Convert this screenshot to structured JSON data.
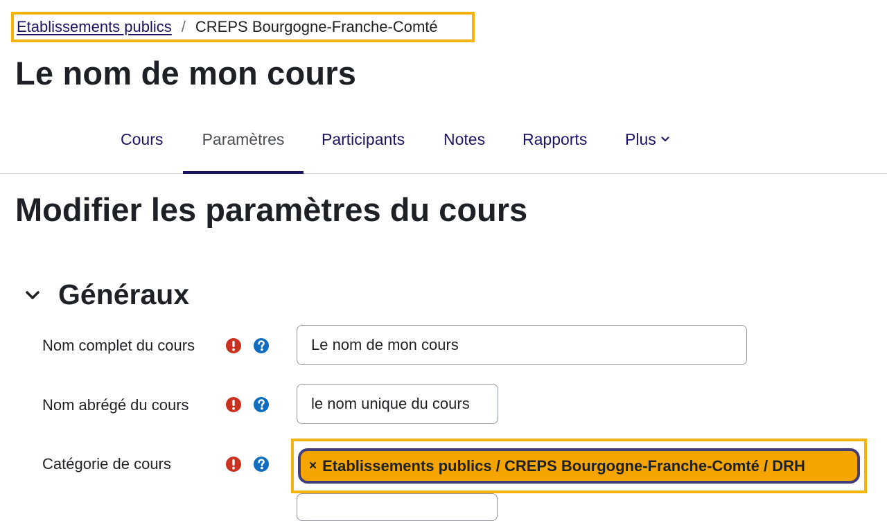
{
  "breadcrumb": {
    "items": [
      {
        "label": "Etablissements publics"
      },
      {
        "label": "CREPS Bourgogne-Franche-Comté"
      }
    ],
    "separator": "/"
  },
  "course_title": "Le nom de mon cours",
  "nav": {
    "tabs": [
      {
        "label": "Cours"
      },
      {
        "label": "Paramètres",
        "active": true
      },
      {
        "label": "Participants"
      },
      {
        "label": "Notes"
      },
      {
        "label": "Rapports"
      },
      {
        "label": "Plus"
      }
    ]
  },
  "page_heading": "Modifier les paramètres du cours",
  "section": {
    "title": "Généraux",
    "fields": [
      {
        "label": "Nom complet du cours",
        "value": "Le nom de mon cours"
      },
      {
        "label": "Nom abrégé du cours",
        "value": "le nom unique du cours"
      },
      {
        "label": "Catégorie de cours",
        "selected": "Etablissements publics / CREPS Bourgogne-Franche-Comté / DRH",
        "remove_glyph": "×"
      }
    ]
  },
  "icons": {
    "required": "exclamation-circle-icon",
    "help": "question-circle-icon",
    "collapse": "chevron-down-icon"
  },
  "colors": {
    "accent_nav": "#1b1464",
    "required": "#ca3120",
    "help": "#0f6cbf",
    "highlight": "#f6b30a",
    "chip_bg": "#f6a500",
    "chip_border": "#3f3d7a"
  }
}
